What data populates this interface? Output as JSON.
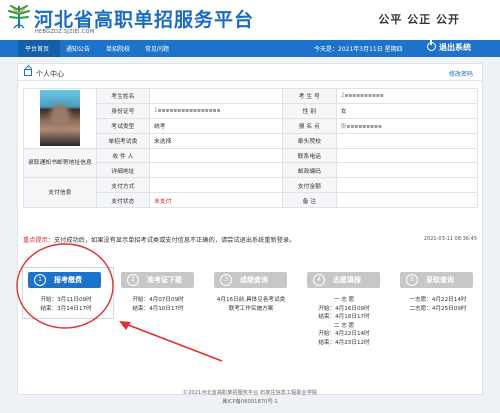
{
  "header": {
    "title": "河北省高职单招服务平台",
    "url_text": "HEBGZDZ.SJZIEI.COM",
    "slogan": "公平  公正  公开"
  },
  "nav": {
    "items": [
      "平台首页",
      "通知公告",
      "单招院校",
      "常见问题"
    ],
    "today": "今天是：2021年3月11日 星期四",
    "logout": "退出系统"
  },
  "panel": {
    "title": "个人中心",
    "edit_link": "修改密码"
  },
  "info": {
    "name_label": "考生姓名",
    "name_value": "",
    "kh_label": "考 生 号",
    "kh_value": "2▪▪▪▪▪▪▪▪▪▪",
    "id_label": "身份证号",
    "id_value": "1▪▪▪▪▪▪▪▪▪▪▪▪▪▪▪▪",
    "gender_label": "性    别",
    "gender_value": "女",
    "type_label": "考试类型",
    "type_value": "统考",
    "site_label": "报 名 点",
    "site_value": "衡▪▪▪▪▪▪▪▪▪",
    "dz_label": "单招考试类",
    "dz_value": "未选择",
    "lead_label": "牵头院校",
    "lead_value": "",
    "notice_side": "录取通知书邮寄地址信息",
    "receiver_label": "收 件 人",
    "receiver_value": "",
    "phone_label": "联系电话",
    "phone_value": "",
    "address_label": "详细地址",
    "address_value": "",
    "zip_label": "邮政编码",
    "zip_value": "",
    "pay_side": "支付信息",
    "paymethod_label": "支付方式",
    "paymethod_value": "",
    "payamount_label": "支付金额",
    "payamount_value": "",
    "paystatus_label": "支付状态",
    "paystatus_value": "未支付",
    "remark_label": "备    注",
    "remark_value": ""
  },
  "notice": {
    "prefix": "重点提示：",
    "text": "支付成功后，如果没有显示单招考试类或支付信息不正确的，请尝试退出系统重新登录。",
    "time": "2021-03-11 08:36:45"
  },
  "steps": [
    {
      "num": "1",
      "label": "报考缴费",
      "lines": [
        "开始：3月11日09时",
        "结束：3月14日17时"
      ]
    },
    {
      "num": "2",
      "label": "准考证下载",
      "lines": [
        "开始：4月07日09时",
        "结束：4月10日17时"
      ]
    },
    {
      "num": "3",
      "label": "成绩查询",
      "lines": [
        "4月16日前,具体见各考试类",
        "联考工作实施方案"
      ]
    },
    {
      "num": "4",
      "label": "志愿填报",
      "lines": [
        "一 志 愿",
        "开始：4月16日09时",
        "结束：4月18日17时",
        "二 志 愿",
        "开始：4月22日14时",
        "结束：4月23日12时"
      ]
    },
    {
      "num": "5",
      "label": "录取查询",
      "lines": [
        "一志愿：4月22日14时",
        "二志愿：4月25日09时"
      ]
    }
  ],
  "footer": {
    "line1": "©2021河北省高职单招服务平台  石家庄信息工程职业学院",
    "line2": "冀ICP备06001870号-1"
  },
  "colors": {
    "brand": "#1d73c9",
    "alert": "#e02020",
    "inactive_step": "#c7c7c7"
  }
}
